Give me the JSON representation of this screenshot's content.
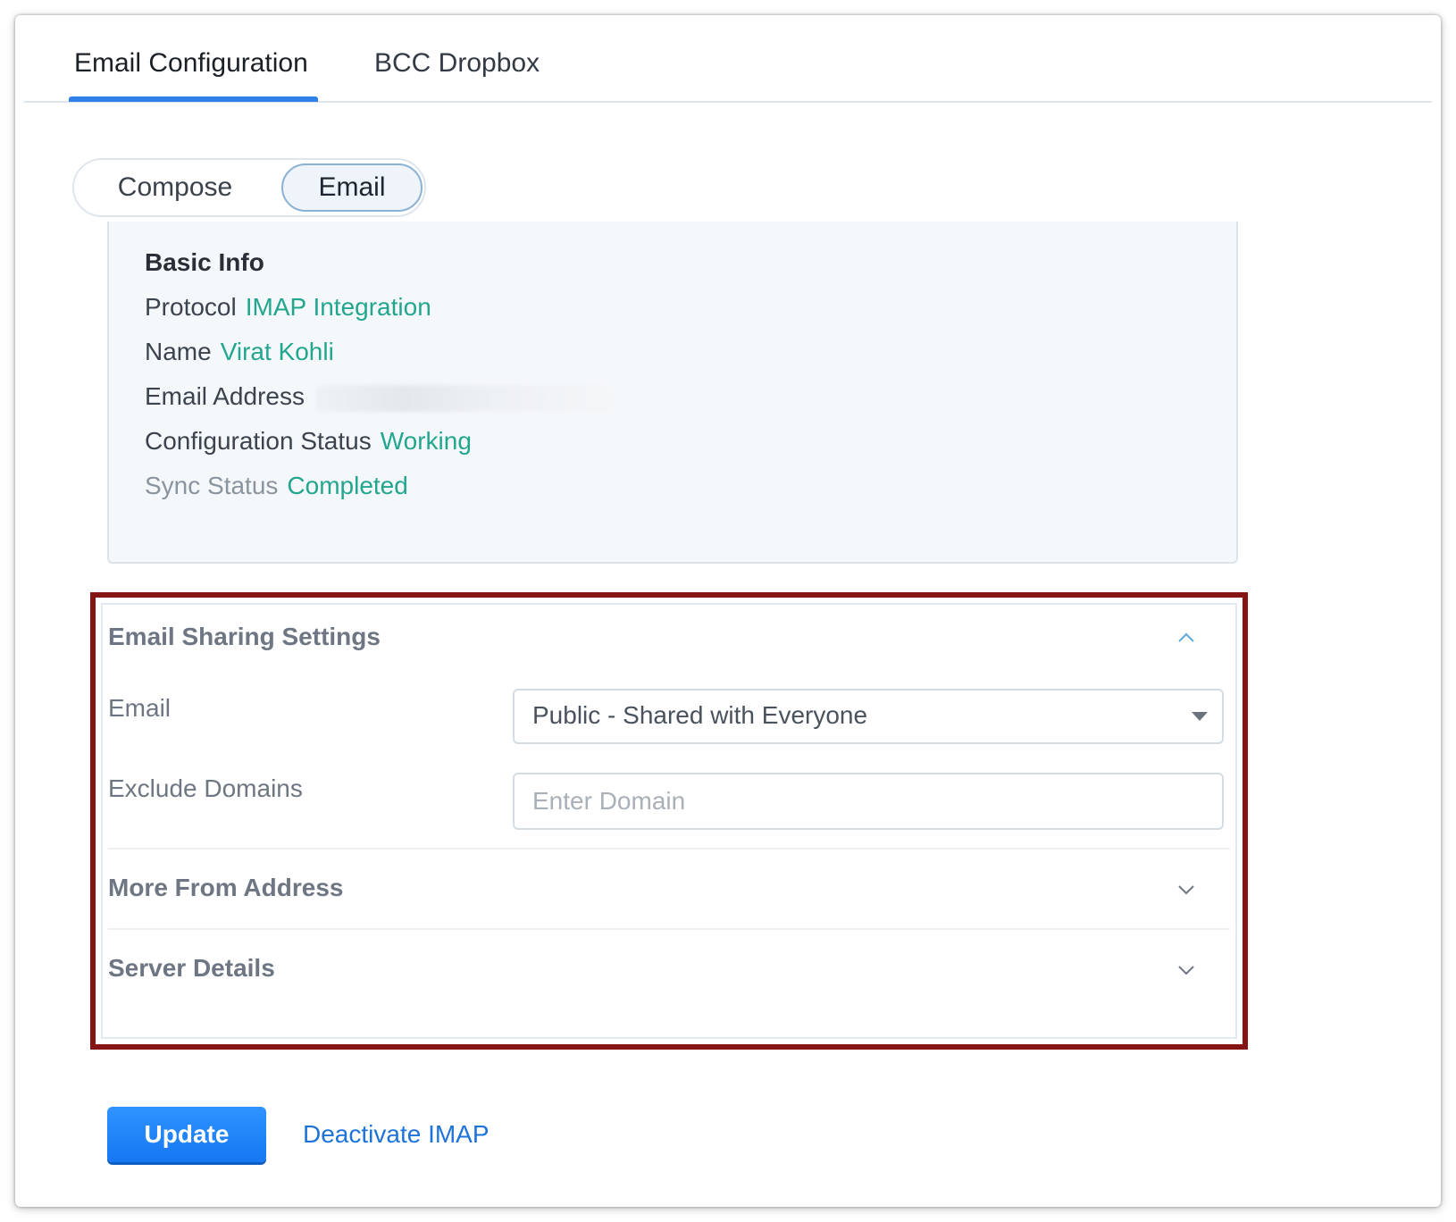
{
  "tabs": [
    {
      "label": "Email Configuration",
      "active": true
    },
    {
      "label": "BCC Dropbox",
      "active": false
    }
  ],
  "segment": {
    "options": [
      "Compose",
      "Email"
    ],
    "selected": "Email"
  },
  "basic_info": {
    "title": "Basic Info",
    "protocol": {
      "label": "Protocol",
      "value": "IMAP Integration"
    },
    "name": {
      "label": "Name",
      "value": "Virat Kohli"
    },
    "email_address": {
      "label": "Email Address"
    },
    "configuration_status": {
      "label": "Configuration Status",
      "value": "Working"
    },
    "sync_status": {
      "label": "Sync Status",
      "value": "Completed"
    }
  },
  "email_sharing": {
    "title": "Email Sharing Settings",
    "expanded": true,
    "email_label": "Email",
    "email_value": "Public - Shared with Everyone",
    "exclude_label": "Exclude Domains",
    "exclude_placeholder": "Enter Domain"
  },
  "more_from_address": {
    "title": "More From Address",
    "expanded": false
  },
  "server_details": {
    "title": "Server Details",
    "expanded": false
  },
  "actions": {
    "update_label": "Update",
    "deactivate_label": "Deactivate IMAP"
  },
  "colors": {
    "accent_blue": "#2f80e8",
    "value_green": "#22a68e",
    "highlight_border": "#861414",
    "button_blue": "#1677f2"
  },
  "icons": {
    "expanded": "chevron-up-icon",
    "collapsed": "chevron-down-icon",
    "dropdown": "caret-down-icon"
  }
}
